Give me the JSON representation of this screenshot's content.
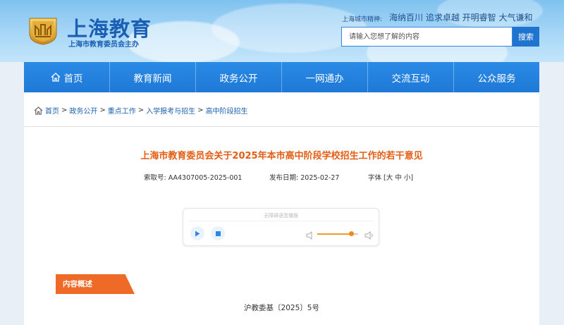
{
  "header": {
    "site_title": "上海教育",
    "site_subtitle": "上海市教育委员会主办",
    "spirit_label": "上海城市精神:",
    "spirit_motto": "海纳百川 追求卓越 开明睿智 大气谦和",
    "search": {
      "placeholder": "请输入您想了解的内容",
      "button_label": "搜索"
    },
    "logo_icon": "education-emblem-icon"
  },
  "nav": {
    "items": [
      {
        "label": "首页",
        "icon": "home-icon"
      },
      {
        "label": "教育新闻"
      },
      {
        "label": "政务公开"
      },
      {
        "label": "一网通办"
      },
      {
        "label": "交流互动"
      },
      {
        "label": "公众服务"
      }
    ]
  },
  "breadcrumb": {
    "items": [
      "首页",
      "政务公开",
      "重点工作",
      "入学报考与招生",
      "高中阶段招生"
    ],
    "separator": ">"
  },
  "article": {
    "title": "上海市教育委员会关于2025年本市高中阶段学校招生工作的若干意见",
    "index_label": "索取号:",
    "index_value": "AA4307005-2025-001",
    "date_label": "发布日期:",
    "date_value": "2025-02-27",
    "font_label": "字体",
    "font_sizes": [
      "大",
      "中",
      "小"
    ],
    "summary_label": "内容概述",
    "doc_number": "沪教委基〔2025〕5号"
  },
  "player": {
    "label": "无障碍语音播报",
    "volume_level": 0.82
  },
  "colors": {
    "nav_blue": "#1f78d6",
    "title_orange": "#e35e14",
    "tag_orange": "#ef6a26",
    "link_blue": "#1c5fb0"
  }
}
